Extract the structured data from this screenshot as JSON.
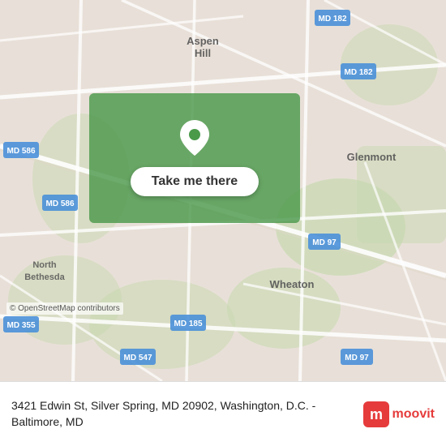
{
  "map": {
    "overlay": {
      "button_label": "Take me there"
    },
    "copyright": "© OpenStreetMap contributors",
    "address": "3421 Edwin St, Silver Spring, MD 20902, Washington, D.C. - Baltimore, MD"
  },
  "moovit": {
    "label": "moovit"
  },
  "road_labels": [
    "MD 182",
    "MD 182",
    "MD 586",
    "MD 586",
    "MD 185",
    "MD 547",
    "MD 355",
    "MD 97",
    "MD 97"
  ],
  "place_labels": [
    "Aspen Hill",
    "Glenmont",
    "North Bethesda",
    "Wheaton"
  ]
}
